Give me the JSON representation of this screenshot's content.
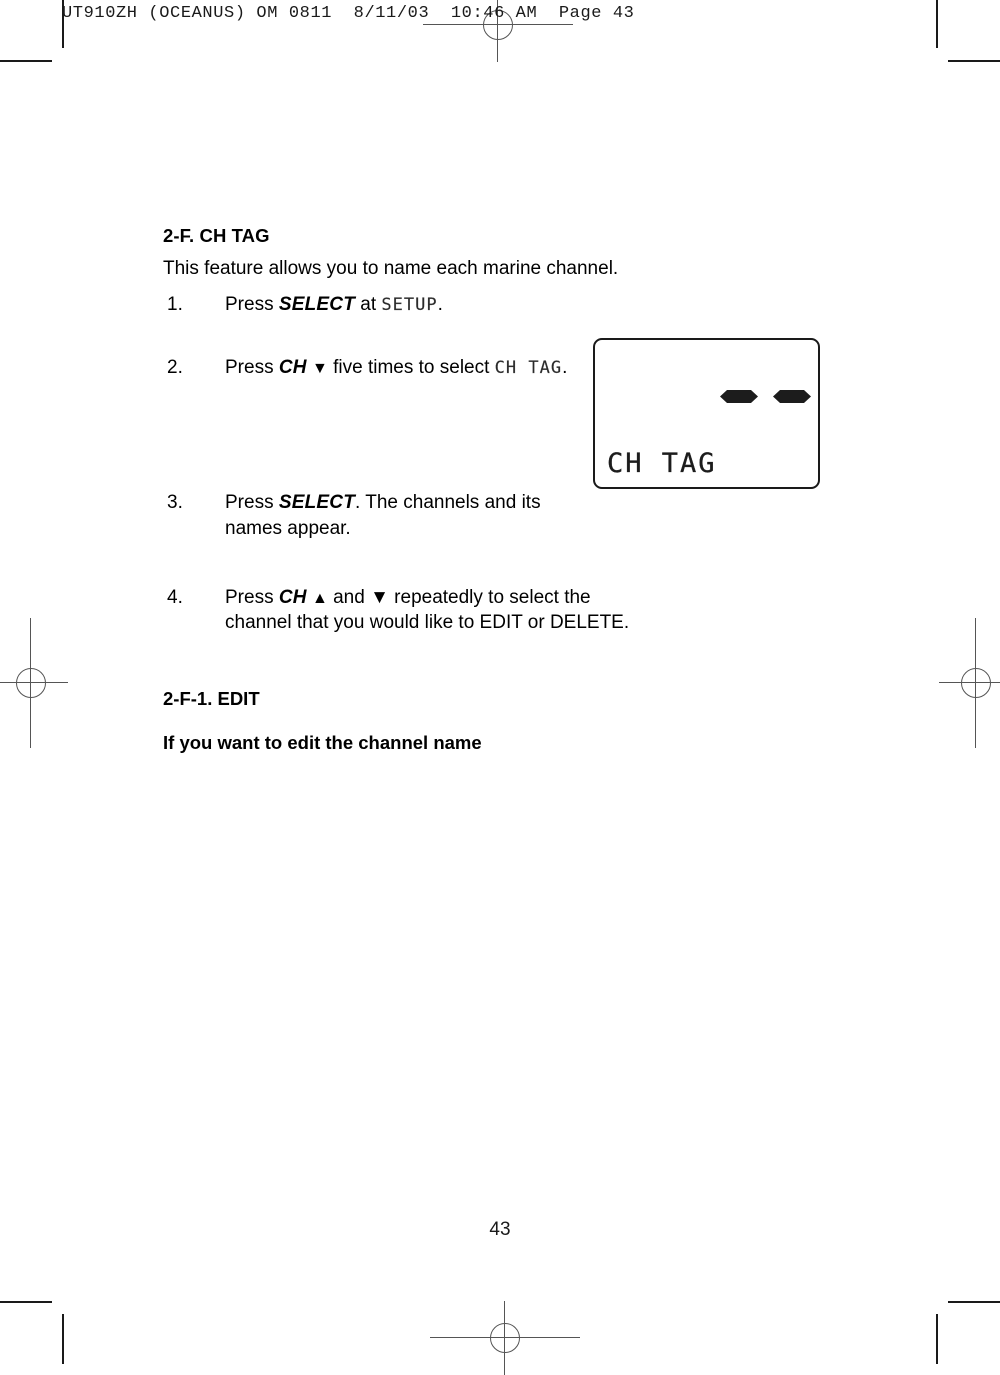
{
  "page_header": "UT910ZH (OCEANUS) OM 0811  8/11/03  10:46 AM  Page 43",
  "section": {
    "heading": "2-F. CH TAG",
    "intro": "This feature allows you to name each marine channel."
  },
  "steps": [
    {
      "number": "1.",
      "text_before": "Press ",
      "emphasis": "SELECT",
      "text_mid": " at ",
      "lcd_token": "SETUP",
      "text_after": "."
    },
    {
      "number": "2.",
      "text_before": "Press ",
      "emphasis": "CH",
      "arrow": "▼",
      "text_mid": " five times to select ",
      "lcd_token": "CH TAG",
      "text_after": "."
    },
    {
      "number": "3.",
      "text_before": "Press ",
      "emphasis": "SELECT",
      "text_mid": ".  The channels and its names appear.",
      "lcd_token": "",
      "text_after": ""
    },
    {
      "number": "4.",
      "text_before": "Press ",
      "emphasis": "CH",
      "arrow": "▲",
      "text_mid": " and ▼ repeatedly to select the channel that you would like to EDIT or DELETE.",
      "lcd_token": "",
      "text_after": ""
    }
  ],
  "subsection": {
    "heading": "2-F-1. EDIT",
    "lead": "If you want to edit the channel name"
  },
  "lcd_figure": {
    "label": "CH TAG",
    "segment_count": 2,
    "segment_glyph": "dash-segment"
  },
  "folio": "43",
  "colors": {
    "ink": "#1a1a1a",
    "lcd_ink": "#1c1c1c",
    "registration": "#555555",
    "paper": "#ffffff"
  }
}
